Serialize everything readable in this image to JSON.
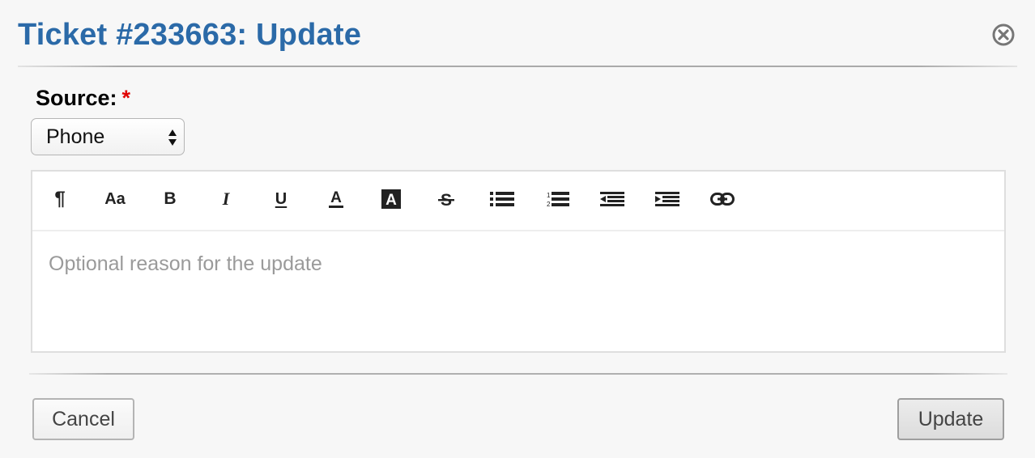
{
  "dialog": {
    "title": "Ticket #233663: Update",
    "close_icon": "close-circle-icon"
  },
  "form": {
    "source_label": "Source:",
    "required_marker": "*",
    "source_selected": "Phone"
  },
  "editor": {
    "toolbar": [
      {
        "name": "paragraph-icon",
        "glyph": "¶"
      },
      {
        "name": "font-size-icon",
        "glyph": "Aa"
      },
      {
        "name": "bold-icon",
        "glyph": "B"
      },
      {
        "name": "italic-icon",
        "glyph": "I"
      },
      {
        "name": "underline-icon",
        "glyph": "U"
      },
      {
        "name": "font-color-icon",
        "glyph": "A"
      },
      {
        "name": "background-color-icon",
        "glyph": "A"
      },
      {
        "name": "strikethrough-icon",
        "glyph": "S"
      },
      {
        "name": "unordered-list-icon"
      },
      {
        "name": "ordered-list-icon"
      },
      {
        "name": "outdent-icon"
      },
      {
        "name": "indent-icon"
      },
      {
        "name": "link-icon"
      }
    ],
    "placeholder": "Optional reason for the update"
  },
  "actions": {
    "cancel_label": "Cancel",
    "update_label": "Update"
  },
  "colors": {
    "title": "#2b6aa8",
    "required": "#e00000",
    "background": "#f7f7f7"
  }
}
